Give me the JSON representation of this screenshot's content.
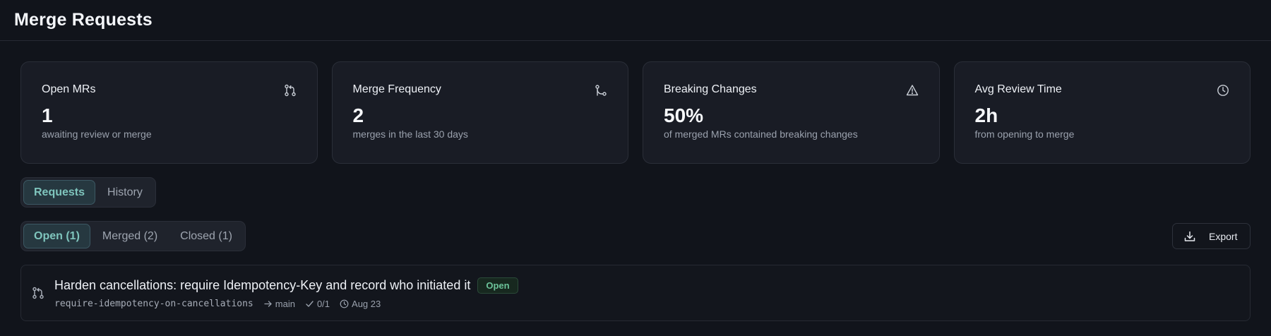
{
  "header": {
    "title": "Merge Requests"
  },
  "stats": [
    {
      "title": "Open MRs",
      "value": "1",
      "subtitle": "awaiting review or merge",
      "icon": "git-pull-request-icon"
    },
    {
      "title": "Merge Frequency",
      "value": "2",
      "subtitle": "merges in the last 30 days",
      "icon": "git-merge-icon"
    },
    {
      "title": "Breaking Changes",
      "value": "50%",
      "subtitle": "of merged MRs contained breaking changes",
      "icon": "warning-triangle-icon"
    },
    {
      "title": "Avg Review Time",
      "value": "2h",
      "subtitle": "from opening to merge",
      "icon": "clock-icon"
    }
  ],
  "view_tabs": [
    {
      "label": "Requests",
      "active": true
    },
    {
      "label": "History",
      "active": false
    }
  ],
  "status_filters": [
    {
      "label": "Open (1)",
      "active": true
    },
    {
      "label": "Merged (2)",
      "active": false
    },
    {
      "label": "Closed (1)",
      "active": false
    }
  ],
  "export": {
    "label": "Export",
    "icon": "download-icon"
  },
  "merge_requests": [
    {
      "title": "Harden cancellations: require Idempotency-Key and record who initiated it",
      "status": "Open",
      "source_branch": "require-idempotency-on-cancellations",
      "target_branch": "main",
      "approvals": "0/1",
      "date": "Aug 23"
    }
  ],
  "colors": {
    "background": "#11141b",
    "card": "#191c25",
    "accent": "#7fc5bd",
    "open_badge": "#6cc39a"
  }
}
